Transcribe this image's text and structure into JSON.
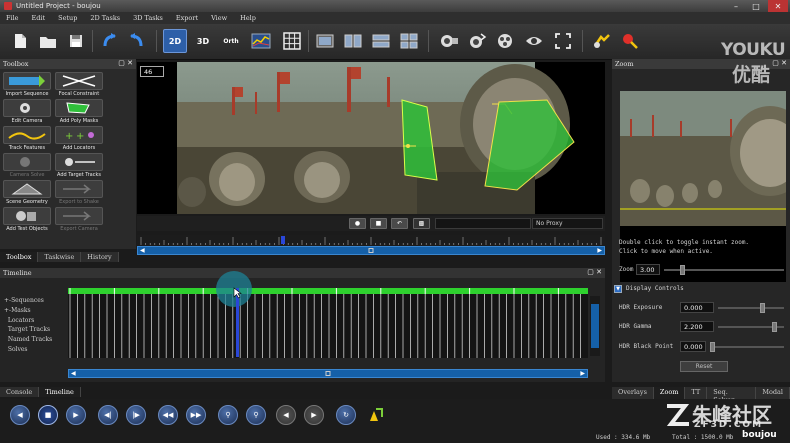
{
  "window": {
    "title": "Untitled Project - boujou",
    "min": "–",
    "max": "□",
    "close": "✕"
  },
  "menu": [
    "File",
    "Edit",
    "Setup",
    "2D Tasks",
    "3D Tasks",
    "Export",
    "View",
    "Help"
  ],
  "toolbar": {
    "view_2d": "2D",
    "view_3d": "3D",
    "view_ortho": "Orth"
  },
  "toolbox": {
    "title": "Toolbox",
    "tools": [
      "Import Sequence",
      "Focal Constraint",
      "Edit Camera",
      "Add Poly Masks",
      "Track Features",
      "Add Locators",
      "Camera Solve",
      "Add Target Tracks",
      "Scene Geometry",
      "Export to Shake",
      "Add Test Objects",
      "Export Camera"
    ],
    "tabs": [
      "Toolbox",
      "Taskwise",
      "History"
    ]
  },
  "viewer": {
    "frame": "46",
    "proxy": "No Proxy"
  },
  "zoom": {
    "title": "Zoom",
    "hint_line1": "Double click to toggle instant zoom.",
    "hint_line2": "Click to move when active.",
    "zoom_label": "Zoom",
    "zoom_value": "3.00",
    "display_controls": "Display Controls",
    "hdr_exposure_label": "HDR Exposure",
    "hdr_exposure_value": "0.000",
    "hdr_gamma_label": "HDR Gamma",
    "hdr_gamma_value": "2.200",
    "hdr_black_label": "HDR Black Point",
    "hdr_black_value": "0.000",
    "reset": "Reset"
  },
  "timeline": {
    "title": "Timeline",
    "tracks": [
      "Sequences",
      "Masks",
      "Locators",
      "Target Tracks",
      "Named Tracks",
      "Solves"
    ]
  },
  "bottom_tabs_left": [
    "Console",
    "Timeline"
  ],
  "bottom_tabs_right": [
    "Overlays",
    "Zoom",
    "TT",
    "Seq. Solver",
    "Modal"
  ],
  "status": {
    "used": "Used : 334.6 Mb",
    "total": "Total : 1500.0 Mb"
  },
  "watermarks": {
    "youku_en": "YOUKU",
    "youku_cn": "优酷",
    "site_cn": "朱峰社区",
    "site_en": "ZF3D.COM",
    "brand": "boujou"
  },
  "colors": {
    "accent_blue": "#1560a8",
    "mask_green": "#2fbf3a",
    "timeline_green": "#2ed12e"
  }
}
